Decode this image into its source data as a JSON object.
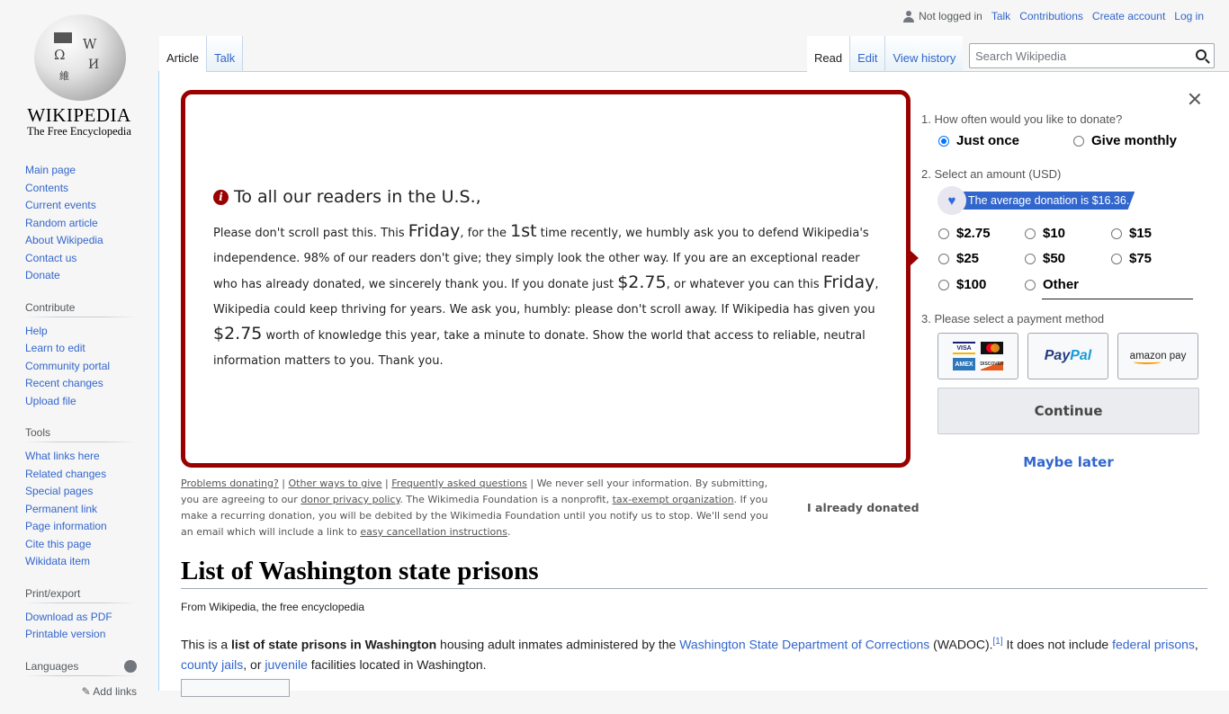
{
  "logo": {
    "wordmark": "WIKIPEDIA",
    "tagline": "The Free Encyclopedia"
  },
  "sidebar": {
    "navigation": [
      "Main page",
      "Contents",
      "Current events",
      "Random article",
      "About Wikipedia",
      "Contact us",
      "Donate"
    ],
    "contribute": {
      "heading": "Contribute",
      "items": [
        "Help",
        "Learn to edit",
        "Community portal",
        "Recent changes",
        "Upload file"
      ]
    },
    "tools": {
      "heading": "Tools",
      "items": [
        "What links here",
        "Related changes",
        "Special pages",
        "Permanent link",
        "Page information",
        "Cite this page",
        "Wikidata item"
      ]
    },
    "print": {
      "heading": "Print/export",
      "items": [
        "Download as PDF",
        "Printable version"
      ]
    },
    "languages": {
      "heading": "Languages",
      "add_links": "Add links"
    }
  },
  "personal": {
    "not_logged_in": "Not logged in",
    "talk": "Talk",
    "contributions": "Contributions",
    "create_account": "Create account",
    "log_in": "Log in"
  },
  "tabs": {
    "article": "Article",
    "talk": "Talk",
    "read": "Read",
    "edit": "Edit",
    "view_history": "View history"
  },
  "search": {
    "placeholder": "Search Wikipedia",
    "value": ""
  },
  "banner": {
    "greeting": "To all our readers in the U.S.,",
    "p": [
      "Please don't scroll past this. This ",
      "Friday",
      ", for the ",
      "1st",
      " time recently, we humbly ask you to defend Wikipedia's independence. 98% of our readers don't give; they simply look the other way. If you are an exceptional reader who has already donated, we sincerely thank you. If you donate just ",
      "$2.75",
      ", or whatever you can this ",
      "Friday",
      ", Wikipedia could keep thriving for years. We ask you, humbly: please don't scroll away. If Wikipedia has given you ",
      "$2.75",
      " worth of knowledge this year, take a minute to donate. Show the world that access to reliable, neutral information matters to you. Thank you."
    ],
    "footnote": {
      "problems": "Problems donating?",
      "other_ways": "Other ways to give",
      "faq": "Frequently asked questions",
      "t1": " We never sell your information. By submitting, you are agreeing to our ",
      "privacy": "donor privacy policy",
      "t2": ". The Wikimedia Foundation is a nonprofit, ",
      "tax_exempt": "tax-exempt organization",
      "t3": ". If you make a recurring donation, you will be debited by the Wikimedia Foundation until you notify us to stop. We'll send you an email which will include a link to ",
      "cancel": "easy cancellation instructions",
      "t4": "."
    },
    "already_donated": "I already donated"
  },
  "donate_form": {
    "step1": "1. How often would you like to donate?",
    "frequency": [
      {
        "label": "Just once",
        "checked": true
      },
      {
        "label": "Give monthly",
        "checked": false
      }
    ],
    "step2": "2. Select an amount (USD)",
    "average": "The average donation is $16.36.",
    "amounts": [
      "$2.75",
      "$10",
      "$15",
      "$25",
      "$50",
      "$75",
      "$100",
      "Other"
    ],
    "other_value": "",
    "step3": "3. Please select a payment method",
    "payment_methods": {
      "cards": [
        "VISA",
        "MasterCard",
        "AMEX",
        "DISCOVER"
      ],
      "paypal_a": "Pay",
      "paypal_b": "Pal",
      "amazon": "amazon pay"
    },
    "continue": "Continue",
    "maybe_later": "Maybe later"
  },
  "article": {
    "title": "List of Washington state prisons",
    "from": "From Wikipedia, the free encyclopedia",
    "lead": {
      "t1": "This is a ",
      "bold": "list of state prisons in Washington",
      "t2": " housing adult inmates administered by the ",
      "link1": "Washington State Department of Corrections",
      "t3": " (WADOC).",
      "ref": "[1]",
      "t4": " It does not include ",
      "link2": "federal prisons",
      "t5": ", ",
      "link3": "county jails",
      "t6": ", or ",
      "link4": "juvenile",
      "t7": " facilities located in Washington."
    }
  }
}
